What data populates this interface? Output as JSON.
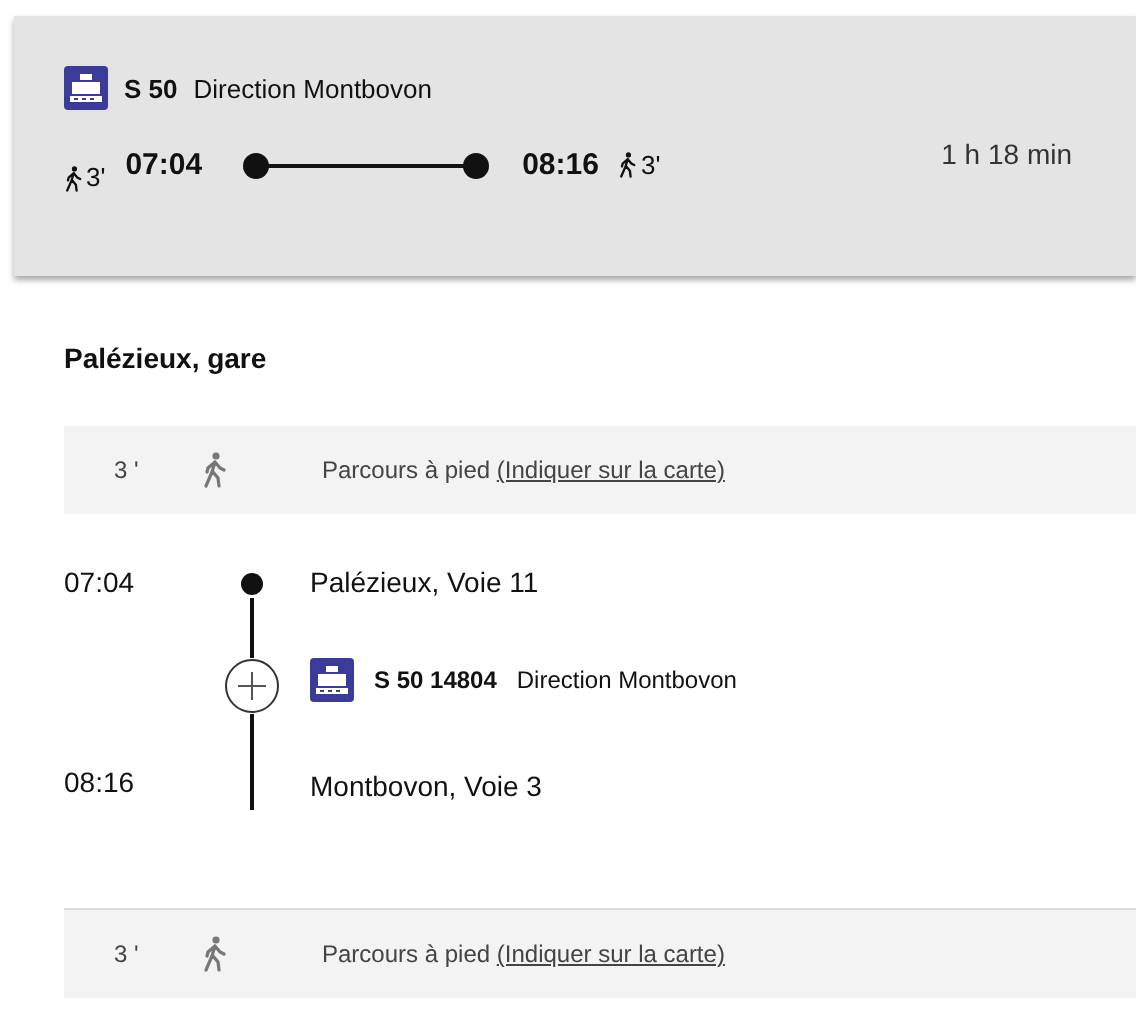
{
  "summary": {
    "line": "S 50",
    "direction": "Direction Montbovon",
    "walk_before": "3'",
    "departure": "07:04",
    "arrival": "08:16",
    "walk_after": "3'",
    "duration": "1 h 18 min"
  },
  "origin_title": "Palézieux, gare",
  "legs": [
    {
      "kind": "walk",
      "minutes": "3 '",
      "text": "Parcours à pied",
      "link": "(Indiquer sur la carte)"
    },
    {
      "kind": "train",
      "dep_time": "07:04",
      "dep_stop": "Palézieux, Voie 11",
      "line": "S 50 14804",
      "direction": "Direction Montbovon",
      "arr_time": "08:16",
      "arr_stop": "Montbovon, Voie 3"
    },
    {
      "kind": "walk",
      "minutes": "3 '",
      "text": "Parcours à pied",
      "link": "(Indiquer sur la carte)"
    }
  ]
}
